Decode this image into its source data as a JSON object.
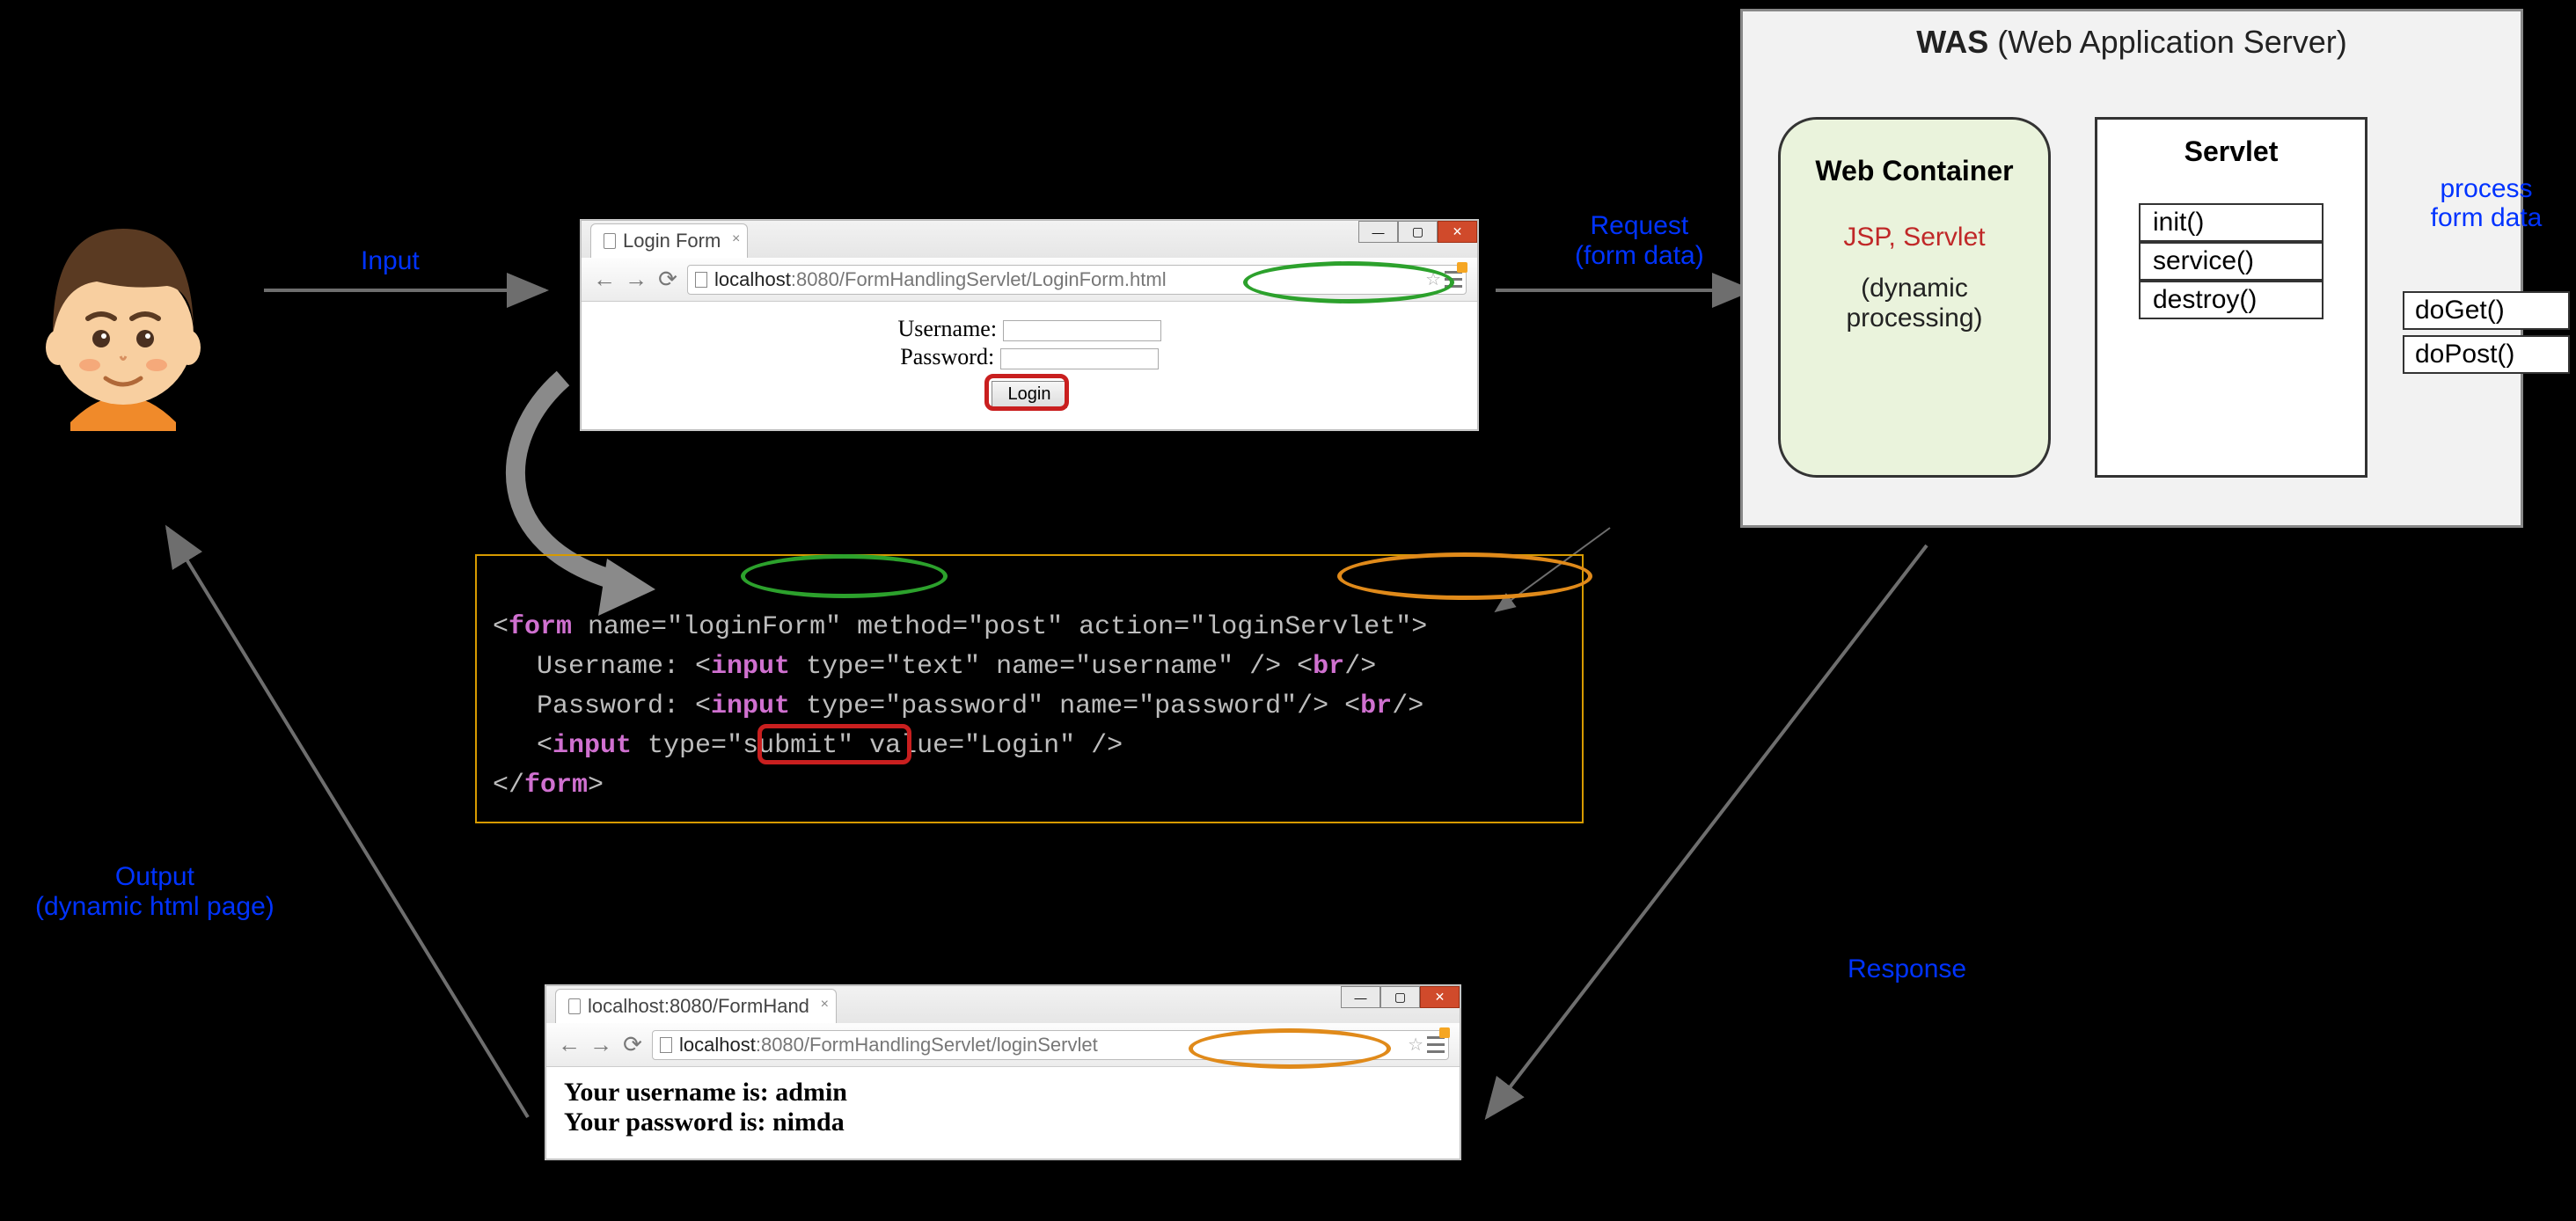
{
  "labels": {
    "input": "Input",
    "request_l1": "Request",
    "request_l2": "(form data)",
    "response": "Response",
    "output_l1": "Output",
    "output_l2": "(dynamic html page)",
    "process_l1": "process",
    "process_l2": "form data"
  },
  "was": {
    "title_bold": "WAS",
    "title_rest": " (Web Application Server)",
    "webcontainer": {
      "title": "Web Container",
      "jsp": "JSP, Servlet",
      "dynamic": "(dynamic\nprocessing)"
    },
    "servlet": {
      "title": "Servlet",
      "methods": [
        "init()",
        "service()",
        "destroy()"
      ],
      "handlers": [
        "doGet()",
        "doPost()"
      ]
    }
  },
  "browser1": {
    "tab_title": "Login Form",
    "url_host": "localhost",
    "url_port_path": ":8080/FormHandlingServlet/LoginForm.html",
    "username_label": "Username:",
    "password_label": "Password:",
    "login_button": "Login"
  },
  "browser2": {
    "tab_title": "localhost:8080/FormHand",
    "url_host": "localhost",
    "url_port_path": ":8080/FormHandlingServlet/loginServlet",
    "out_user": "Your username is: admin",
    "out_pass": "Your password is: nimda"
  },
  "code": {
    "l1_a": "<",
    "l1_form": "form",
    "l1_b": " name=",
    "l1_name": "\"loginForm\"",
    "l1_c": " method=\"post\" action=",
    "l1_action": "\"loginServlet\"",
    "l1_d": ">",
    "l2": "Username: <",
    "l2_input": "input",
    "l2_b": " type=\"text\" name=\"username\" /> <",
    "l2_br": "br",
    "l2_c": "/>",
    "l3": "Password: <",
    "l3_input": "input",
    "l3_b": " type=\"password\" name=\"password\"/> <",
    "l3_br": "br",
    "l3_c": "/>",
    "l4_a": "<",
    "l4_input": "input",
    "l4_b": " type=",
    "l4_submit": "\"submit\"",
    "l4_c": " value=\"Login\" />",
    "l5_a": "</",
    "l5_form": "form",
    "l5_b": ">"
  }
}
